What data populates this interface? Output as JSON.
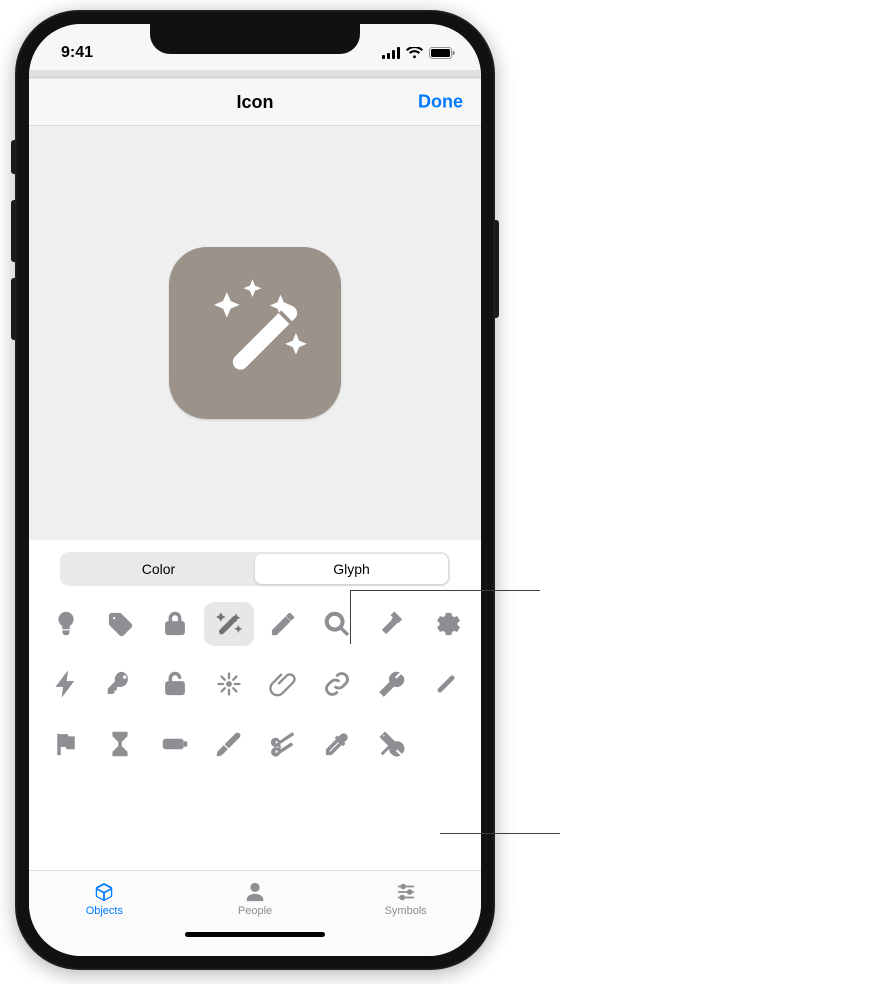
{
  "status": {
    "time": "9:41"
  },
  "nav": {
    "title": "Icon",
    "done": "Done"
  },
  "preview": {
    "glyph": "wand-sparkles-icon",
    "bg_color": "#9b9289"
  },
  "segmented": {
    "items": [
      {
        "label": "Color",
        "active": false
      },
      {
        "label": "Glyph",
        "active": true
      }
    ]
  },
  "glyphs": {
    "rows": [
      [
        "lightbulb-icon",
        "tag-icon",
        "lock-icon",
        "wand-icon",
        "pencil-icon",
        "magnifier-icon",
        "hammer-icon",
        "gear-icon"
      ],
      [
        "bolt-icon",
        "key-icon",
        "lock-open-icon",
        "sparkle-icon",
        "paperclip-icon",
        "link-icon",
        "wrench-icon",
        "slash-icon"
      ],
      [
        "flag-icon",
        "hourglass-icon",
        "battery-icon",
        "paintbrush-icon",
        "scissors-icon",
        "eyedropper-icon",
        "tools-icon",
        ""
      ]
    ],
    "selected": "wand-icon"
  },
  "categories": {
    "items": [
      {
        "label": "Objects",
        "icon": "cube-icon",
        "active": true
      },
      {
        "label": "People",
        "icon": "person-icon",
        "active": false
      },
      {
        "label": "Symbols",
        "icon": "sliders-icon",
        "active": false
      }
    ]
  }
}
